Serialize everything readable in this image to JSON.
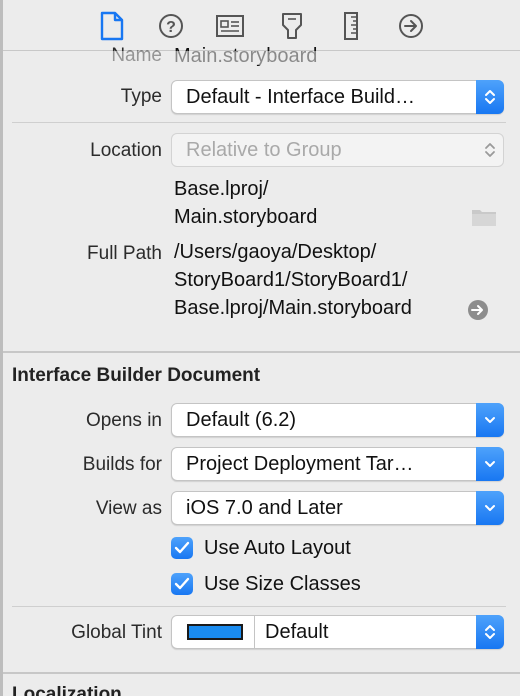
{
  "toolbar": {
    "icons": [
      {
        "name": "file-inspector-icon",
        "active": true
      },
      {
        "name": "quick-help-icon"
      },
      {
        "name": "identity-inspector-icon"
      },
      {
        "name": "attributes-inspector-icon"
      },
      {
        "name": "size-inspector-icon"
      },
      {
        "name": "connections-inspector-icon"
      }
    ]
  },
  "identity": {
    "name_label": "Name",
    "name_value": "Main.storyboard",
    "type_label": "Type",
    "type_value": "Default - Interface Build…"
  },
  "location": {
    "label": "Location",
    "value": "Relative to Group",
    "path_line1": "Base.lproj/",
    "path_line2": "Main.storyboard",
    "full_path_label": "Full Path",
    "full_path_line1": "/Users/gaoya/Desktop/",
    "full_path_line2": "StoryBoard1/StoryBoard1/",
    "full_path_line3": "Base.lproj/Main.storyboard"
  },
  "ib_document": {
    "title": "Interface Builder Document",
    "opens_in_label": "Opens in",
    "opens_in_value": "Default (6.2)",
    "builds_for_label": "Builds for",
    "builds_for_value": "Project Deployment Tar…",
    "view_as_label": "View as",
    "view_as_value": "iOS 7.0 and Later",
    "auto_layout_label": "Use Auto Layout",
    "size_classes_label": "Use Size Classes",
    "global_tint_label": "Global Tint",
    "global_tint_value": "Default",
    "global_tint_color": "#1a8cf0"
  },
  "next_section": {
    "title": "Localization"
  },
  "colors": {
    "accent": "#1877f2",
    "background": "#ececec"
  }
}
